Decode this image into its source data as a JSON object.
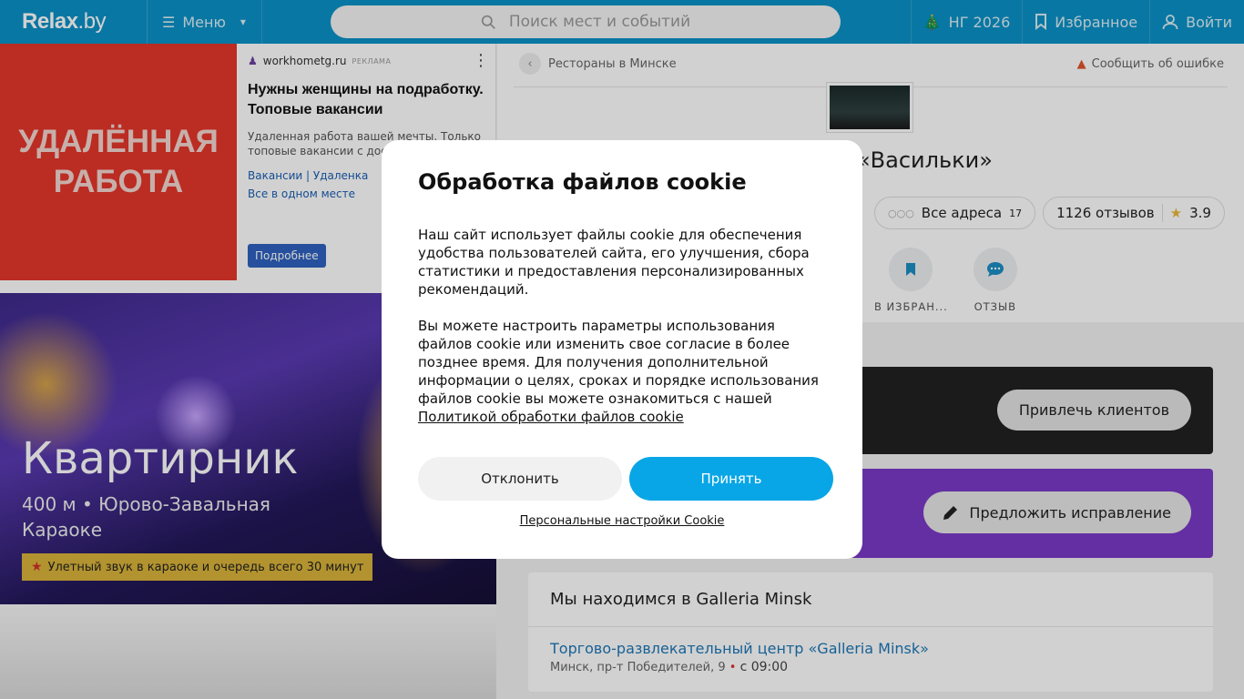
{
  "header": {
    "logo_main": "Relax",
    "logo_suffix": ".by",
    "menu_label": "Меню",
    "search_placeholder": "Поиск мест и событий",
    "ny_label": "НГ 2026",
    "favorites_label": "Избранное",
    "login_label": "Войти"
  },
  "ad": {
    "image_text": "УДАЛЁННАЯ РАБОТА",
    "source": "workhometg.ru",
    "source_tag": "РЕКЛАМА",
    "title": "Нужны женщины на подработку. Топовые вакансии",
    "description": "Удаленная работа вашей мечты. Только топовые вакансии с достойной оплатой",
    "links": "Вакансии  |  Удаленка",
    "links2": "Все в одном месте",
    "button": "Подробнее"
  },
  "hero": {
    "title": "Квартирник",
    "distance_line": "400 м • Юрово-Завальная",
    "category": "Караоке",
    "badge": "Улетный звук в караоке и очередь всего 30 минут"
  },
  "place": {
    "breadcrumb": "Рестораны в Минске",
    "report": "Сообщить об ошибке",
    "name": "«Васильки»",
    "all_addresses": "Все адреса",
    "addresses_count": "17",
    "reviews": "1126 отзывов",
    "rating": "3.9",
    "action_favorite": "В ИЗБРАН...",
    "action_review": "ОТЗЫВ",
    "attract_button": "Привлечь клиентов",
    "suggest_button": "Предложить исправление",
    "location_heading": "Мы находимся в Galleria Minsk",
    "location_link": "Торгово-развлекательный центр «Galleria Minsk»",
    "location_address": "Минск, пр-т Победителей, 9",
    "location_time": "с 09:00"
  },
  "cookie": {
    "title": "Обработка файлов cookie",
    "text1": "Наш сайт использует файлы cookie для обеспечения удобства пользователей сайта, его улучшения, сбора статистики и предоставления персонализированных рекомендаций.",
    "text2": "Вы можете настроить параметры использования файлов cookie или изменить свое согласие в более позднее время. Для получения дополнительной информации о целях, сроках и порядке использования файлов cookie вы можете ознакомиться с нашей",
    "policy_link": "Политикой обработки файлов cookie",
    "decline": "Отклонить",
    "accept": "Принять",
    "settings": "Персональные настройки Cookie"
  },
  "colors": {
    "header_bg": "#0c92c7",
    "accept_bg": "#08a6e6",
    "purple_banner": "#7b3ac6",
    "ad_red": "#e5362b"
  }
}
